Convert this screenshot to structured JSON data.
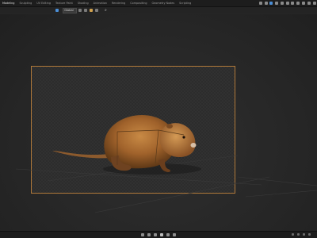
{
  "app": {
    "workspace_tabs": [
      "Modeling",
      "Sculpting",
      "UV Editing",
      "Texture Paint",
      "Shading",
      "Animation",
      "Rendering",
      "Compositing",
      "Geometry Nodes",
      "Scripting"
    ],
    "active_tab_index": 0
  },
  "toolbar": {
    "view_select_value": "Global"
  },
  "icons": {
    "search": "search-icon",
    "play": "play-icon"
  },
  "colors": {
    "frame_border": "#b0793a",
    "accent": "#4b8ed6"
  }
}
